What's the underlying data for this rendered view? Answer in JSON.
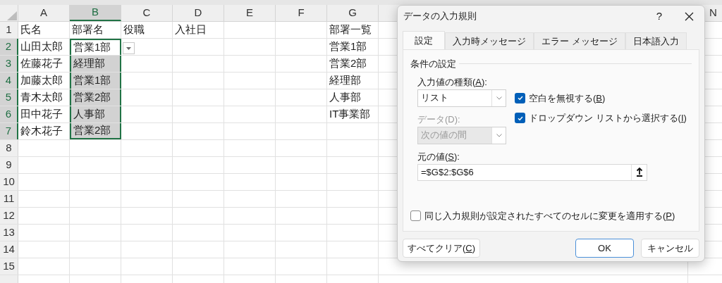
{
  "sheet": {
    "columns": [
      {
        "label": "A",
        "selected": false
      },
      {
        "label": "B",
        "selected": true
      },
      {
        "label": "C",
        "selected": false
      },
      {
        "label": "D",
        "selected": false
      },
      {
        "label": "E",
        "selected": false
      },
      {
        "label": "F",
        "selected": false
      },
      {
        "label": "G",
        "selected": false
      }
    ],
    "edge_column": {
      "label": "N"
    },
    "rows": [
      {
        "label": "1",
        "selected": false,
        "cells": [
          {
            "text": "氏名",
            "selected": false,
            "active": false
          },
          {
            "text": "部署名",
            "selected": false,
            "active": false
          },
          {
            "text": "役職",
            "selected": false,
            "active": false
          },
          {
            "text": "入社日",
            "selected": false,
            "active": false
          },
          null,
          null,
          {
            "text": "部署一覧",
            "selected": false,
            "active": false
          }
        ]
      },
      {
        "label": "2",
        "selected": true,
        "cells": [
          {
            "text": "山田太郎",
            "selected": false,
            "active": false
          },
          {
            "text": "営業1部",
            "selected": true,
            "active": true
          },
          null,
          null,
          null,
          null,
          {
            "text": "営業1部",
            "selected": false,
            "active": false
          }
        ]
      },
      {
        "label": "3",
        "selected": true,
        "cells": [
          {
            "text": "佐藤花子",
            "selected": false,
            "active": false
          },
          {
            "text": "経理部",
            "selected": true,
            "active": false
          },
          null,
          null,
          null,
          null,
          {
            "text": "営業2部",
            "selected": false,
            "active": false
          }
        ]
      },
      {
        "label": "4",
        "selected": true,
        "cells": [
          {
            "text": "加藤太郎",
            "selected": false,
            "active": false
          },
          {
            "text": "営業1部",
            "selected": true,
            "active": false
          },
          null,
          null,
          null,
          null,
          {
            "text": "経理部",
            "selected": false,
            "active": false
          }
        ]
      },
      {
        "label": "5",
        "selected": true,
        "cells": [
          {
            "text": "青木太郎",
            "selected": false,
            "active": false
          },
          {
            "text": "営業2部",
            "selected": true,
            "active": false
          },
          null,
          null,
          null,
          null,
          {
            "text": "人事部",
            "selected": false,
            "active": false
          }
        ]
      },
      {
        "label": "6",
        "selected": true,
        "cells": [
          {
            "text": "田中花子",
            "selected": false,
            "active": false
          },
          {
            "text": "人事部",
            "selected": true,
            "active": false
          },
          null,
          null,
          null,
          null,
          {
            "text": "IT事業部",
            "selected": false,
            "active": false
          }
        ]
      },
      {
        "label": "7",
        "selected": true,
        "cells": [
          {
            "text": "鈴木花子",
            "selected": false,
            "active": false
          },
          {
            "text": "営業2部",
            "selected": true,
            "active": false
          }
        ]
      },
      {
        "label": "8",
        "selected": false
      },
      {
        "label": "9",
        "selected": false
      },
      {
        "label": "10",
        "selected": false
      },
      {
        "label": "11",
        "selected": false
      },
      {
        "label": "12",
        "selected": false
      },
      {
        "label": "13",
        "selected": false
      },
      {
        "label": "14",
        "selected": false
      },
      {
        "label": "15",
        "selected": false
      }
    ]
  },
  "dialog": {
    "title": "データの入力規則",
    "help": "?",
    "tabs": [
      {
        "label": "設定",
        "selected": true
      },
      {
        "label": "入力時メッセージ",
        "selected": false
      },
      {
        "label": "エラー メッセージ",
        "selected": false
      },
      {
        "label": "日本語入力",
        "selected": false
      }
    ],
    "section": "条件の設定",
    "allow": {
      "label": {
        "before": "入力値の種類(",
        "key": "A",
        "after": "):"
      },
      "value": "リスト",
      "disabled": false
    },
    "data": {
      "label": {
        "before": "データ(D):"
      },
      "value": "次の値の間",
      "disabled": true
    },
    "options": [
      {
        "label": {
          "before": "空白を無視する(",
          "key": "B",
          "after": ")"
        },
        "checked": true
      },
      {
        "label": {
          "before": "ドロップダウン リストから選択する(",
          "key": "I",
          "after": ")"
        },
        "checked": true
      }
    ],
    "source": {
      "label": {
        "before": "元の値(",
        "key": "S",
        "after": "):"
      },
      "value": "=$G$2:$G$6"
    },
    "apply_all": {
      "label": {
        "before": "同じ入力規則が設定されたすべてのセルに変更を適用する(",
        "key": "P",
        "after": ")"
      },
      "checked": false
    },
    "buttons": [
      {
        "label": {
          "before": "すべてクリア(",
          "key": "C",
          "after": ")"
        },
        "default": false
      },
      {
        "label": {
          "before": "OK"
        },
        "default": true
      },
      {
        "label": {
          "before": "キャンセル"
        },
        "default": false
      }
    ]
  }
}
